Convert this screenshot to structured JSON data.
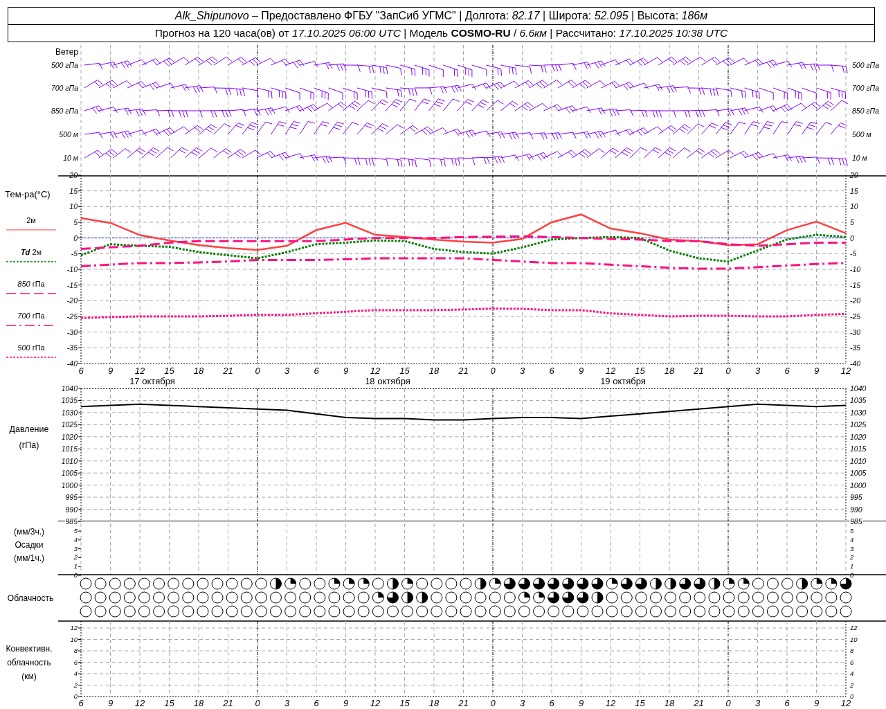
{
  "header": {
    "line_1": "*Alk_Shipunovo* – Предоставлено ФГБУ \"ЗапСиб УГМС\" | Долгота: *82.17* | Широта: *52.095* | Высота: *186м*",
    "line_2": "Прогноз на 120 часа(ов) от *17.10.2025 06:00 UTC* | Модель **COSMO-RU** / *6.6км* | Рассчитано: *17.10.2025 10:38 UTC*"
  },
  "wind": {
    "title": "Ветер",
    "levels": [
      {
        "label": "500 гПа",
        "label_right": "500 гПа"
      },
      {
        "label": "700 гПа",
        "label_right": "700 гПа"
      },
      {
        "label": "850 гПа",
        "label_right": "850 гПа"
      },
      {
        "label": "500 м",
        "label_right": "500 м"
      },
      {
        "label": "10  м",
        "label_right": "10  м"
      }
    ]
  },
  "temperature": {
    "title": "Тем-ра(°C)",
    "right_ticks": [
      "20",
      "15",
      "10",
      "5",
      "0",
      "-5",
      "-10",
      "-15",
      "-20",
      "-25",
      "-30",
      "-35",
      "-40"
    ],
    "dates": [
      "17 октября",
      "18 октября",
      "19 октября"
    ],
    "chart_data": {
      "type": "line",
      "grid": true,
      "ref_lines": [
        {
          "axis": "y",
          "value": 0,
          "color": "#2040ff"
        }
      ],
      "categories": [
        "6",
        "9",
        "12",
        "15",
        "18",
        "21",
        "0",
        "3",
        "6",
        "9",
        "12",
        "15",
        "18",
        "21",
        "0",
        "3",
        "6",
        "9",
        "12",
        "15",
        "18",
        "21",
        "0",
        "3",
        "6",
        "9",
        "12"
      ],
      "ylim": [
        -40,
        20
      ],
      "yticks": [
        20,
        15,
        10,
        5,
        0,
        -5,
        -10,
        -15,
        -20,
        -25,
        -30,
        -35,
        -40
      ],
      "series": [
        {
          "name": "2м",
          "line_style": "solid",
          "color": "#ff4040",
          "values": [
            6.3,
            4.8,
            0.9,
            -0.8,
            -2.3,
            -3.2,
            -3.8,
            -2.5,
            2.5,
            4.8,
            1.0,
            0.3,
            -0.5,
            -1.2,
            -1.5,
            -0.3,
            5.0,
            7.5,
            3.0,
            1.5,
            -0.5,
            -1.0,
            -2.3,
            -2.0,
            2.5,
            5.2,
            1.5
          ]
        },
        {
          "name": "**Td** 2м",
          "line_style": "dotted",
          "color": "#008000",
          "values": [
            -5.5,
            -2.0,
            -2.5,
            -2.8,
            -4.5,
            -5.5,
            -6.5,
            -4.5,
            -2.0,
            -1.5,
            -0.8,
            -1.0,
            -3.5,
            -4.5,
            -5.0,
            -3.0,
            -0.5,
            0.0,
            0.3,
            0.0,
            -4.0,
            -6.5,
            -7.5,
            -4.0,
            -0.5,
            1.0,
            0.3
          ]
        },
        {
          "name": "*850* гПа",
          "line_style": "dashed",
          "color": "#ff1080",
          "values": [
            -3.5,
            -3.0,
            -2.5,
            -1.5,
            -1.0,
            -1.0,
            -1.0,
            -1.0,
            -1.0,
            -0.5,
            0.0,
            0.0,
            0.0,
            0.3,
            0.4,
            0.5,
            0.3,
            0.0,
            -0.3,
            -0.5,
            -1.0,
            -1.0,
            -2.0,
            -2.5,
            -2.0,
            -1.5,
            -1.5
          ]
        },
        {
          "name": "*700* гПа",
          "line_style": "dashdot",
          "color": "#ff1080",
          "values": [
            -9.0,
            -8.5,
            -8.0,
            -8.0,
            -7.8,
            -7.5,
            -7.0,
            -7.0,
            -7.0,
            -6.8,
            -6.5,
            -6.5,
            -6.5,
            -6.5,
            -7.0,
            -7.5,
            -8.0,
            -8.0,
            -8.5,
            -9.0,
            -9.5,
            -9.8,
            -9.8,
            -9.3,
            -8.8,
            -8.3,
            -8.0
          ]
        },
        {
          "name": "*500* гПа",
          "line_style": "dotted",
          "color": "#ff1080",
          "values": [
            -25.5,
            -25.2,
            -25.0,
            -25.0,
            -25.0,
            -24.8,
            -24.5,
            -24.5,
            -24.0,
            -23.5,
            -23.0,
            -23.0,
            -23.0,
            -22.8,
            -22.5,
            -22.6,
            -23.0,
            -23.0,
            -24.0,
            -24.5,
            -25.0,
            -24.8,
            -24.8,
            -25.0,
            -25.0,
            -24.5,
            -24.2
          ]
        }
      ]
    }
  },
  "pressure": {
    "title": "Давление",
    "unit": "(гПа)",
    "right_ticks": [
      "1040",
      "1035",
      "1030",
      "1025",
      "1020",
      "1015",
      "1010",
      "1005",
      "1000",
      "995",
      "990",
      "985"
    ],
    "chart_data": {
      "type": "line",
      "grid": true,
      "ylim": [
        985,
        1040
      ],
      "yticks": [
        1040,
        1035,
        1030,
        1025,
        1020,
        1015,
        1010,
        1005,
        1000,
        995,
        990,
        985
      ],
      "series": [
        {
          "color": "#000000",
          "values": [
            1032.5,
            1033,
            1033.5,
            1033,
            1032.5,
            1032,
            1031.5,
            1031,
            1029.5,
            1028,
            1027.5,
            1027.5,
            1027,
            1027,
            1027.5,
            1028,
            1028,
            1027.5,
            1028.5,
            1029.5,
            1030.5,
            1031.5,
            1032.5,
            1033.5,
            1033,
            1032.5,
            1033
          ]
        }
      ]
    }
  },
  "precipitation": {
    "unit_top": "(мм/3ч.)",
    "title": "Осадки",
    "unit_bottom": "(мм/1ч.)",
    "ticks": [
      "5",
      "4",
      "3",
      "2",
      "1",
      "0"
    ],
    "right_ticks": [
      "5",
      "4",
      "3",
      "2",
      "1",
      "0"
    ]
  },
  "cloudiness": {
    "title": "Облачность",
    "rows": [
      {
        "cells": [
          {
            "kind": "clear"
          },
          {
            "kind": "clear"
          },
          {
            "kind": "clear"
          },
          {
            "kind": "clear"
          },
          {
            "kind": "clear"
          },
          {
            "kind": "clear"
          },
          {
            "kind": "clear"
          },
          {
            "kind": "clear"
          },
          {
            "kind": "clear"
          },
          {
            "kind": "clear"
          },
          {
            "kind": "clear"
          },
          {
            "kind": "clear"
          },
          {
            "kind": "clear"
          },
          {
            "kind": "half"
          },
          {
            "kind": "quarter"
          },
          {
            "kind": "clear"
          },
          {
            "kind": "clear"
          },
          {
            "kind": "quarter"
          },
          {
            "kind": "quarter"
          },
          {
            "kind": "quarter"
          },
          {
            "kind": "clear"
          },
          {
            "kind": "half"
          },
          {
            "kind": "quarter"
          },
          {
            "kind": "clear"
          },
          {
            "kind": "clear"
          },
          {
            "kind": "clear"
          },
          {
            "kind": "clear"
          },
          {
            "kind": "half"
          },
          {
            "kind": "quarter"
          },
          {
            "kind": "three_quarters"
          },
          {
            "kind": "three_quarters"
          },
          {
            "kind": "three_quarters"
          },
          {
            "kind": "three_quarters"
          },
          {
            "kind": "three_quarters"
          },
          {
            "kind": "three_quarters"
          },
          {
            "kind": "three_quarters"
          },
          {
            "kind": "quarter"
          },
          {
            "kind": "three_quarters"
          },
          {
            "kind": "three_quarters"
          },
          {
            "kind": "half"
          },
          {
            "kind": "half"
          },
          {
            "kind": "three_quarters"
          },
          {
            "kind": "three_quarters"
          },
          {
            "kind": "half"
          },
          {
            "kind": "quarter"
          },
          {
            "kind": "quarter"
          },
          {
            "kind": "clear"
          },
          {
            "kind": "clear"
          },
          {
            "kind": "clear"
          },
          {
            "kind": "half"
          },
          {
            "kind": "quarter"
          },
          {
            "kind": "quarter"
          },
          {
            "kind": "three_quarters"
          }
        ]
      },
      {
        "cells": [
          {
            "kind": "clear"
          },
          {
            "kind": "clear"
          },
          {
            "kind": "clear"
          },
          {
            "kind": "clear"
          },
          {
            "kind": "clear"
          },
          {
            "kind": "clear"
          },
          {
            "kind": "clear"
          },
          {
            "kind": "clear"
          },
          {
            "kind": "clear"
          },
          {
            "kind": "clear"
          },
          {
            "kind": "clear"
          },
          {
            "kind": "clear"
          },
          {
            "kind": "clear"
          },
          {
            "kind": "clear"
          },
          {
            "kind": "clear"
          },
          {
            "kind": "clear"
          },
          {
            "kind": "clear"
          },
          {
            "kind": "clear"
          },
          {
            "kind": "clear"
          },
          {
            "kind": "clear"
          },
          {
            "kind": "quarter"
          },
          {
            "kind": "three_quarters"
          },
          {
            "kind": "half"
          },
          {
            "kind": "half"
          },
          {
            "kind": "clear"
          },
          {
            "kind": "clear"
          },
          {
            "kind": "clear"
          },
          {
            "kind": "clear"
          },
          {
            "kind": "clear"
          },
          {
            "kind": "clear"
          },
          {
            "kind": "quarter"
          },
          {
            "kind": "quarter"
          },
          {
            "kind": "three_quarters"
          },
          {
            "kind": "three_quarters"
          },
          {
            "kind": "three_quarters"
          },
          {
            "kind": "half"
          },
          {
            "kind": "clear"
          },
          {
            "kind": "clear"
          },
          {
            "kind": "clear"
          },
          {
            "kind": "clear"
          },
          {
            "kind": "clear"
          },
          {
            "kind": "clear"
          },
          {
            "kind": "clear"
          },
          {
            "kind": "clear"
          },
          {
            "kind": "clear"
          },
          {
            "kind": "clear"
          },
          {
            "kind": "clear"
          },
          {
            "kind": "clear"
          },
          {
            "kind": "clear"
          },
          {
            "kind": "clear"
          },
          {
            "kind": "clear"
          },
          {
            "kind": "clear"
          },
          {
            "kind": "clear"
          }
        ]
      },
      {
        "cells": [
          {
            "kind": "clear"
          },
          {
            "kind": "clear"
          },
          {
            "kind": "clear"
          },
          {
            "kind": "clear"
          },
          {
            "kind": "clear"
          },
          {
            "kind": "clear"
          },
          {
            "kind": "clear"
          },
          {
            "kind": "clear"
          },
          {
            "kind": "clear"
          },
          {
            "kind": "clear"
          },
          {
            "kind": "clear"
          },
          {
            "kind": "clear"
          },
          {
            "kind": "clear"
          },
          {
            "kind": "clear"
          },
          {
            "kind": "clear"
          },
          {
            "kind": "clear"
          },
          {
            "kind": "clear"
          },
          {
            "kind": "clear"
          },
          {
            "kind": "clear"
          },
          {
            "kind": "clear"
          },
          {
            "kind": "clear"
          },
          {
            "kind": "clear"
          },
          {
            "kind": "clear"
          },
          {
            "kind": "clear"
          },
          {
            "kind": "clear"
          },
          {
            "kind": "clear"
          },
          {
            "kind": "clear"
          },
          {
            "kind": "clear"
          },
          {
            "kind": "clear"
          },
          {
            "kind": "clear"
          },
          {
            "kind": "clear"
          },
          {
            "kind": "clear"
          },
          {
            "kind": "clear"
          },
          {
            "kind": "clear"
          },
          {
            "kind": "clear"
          },
          {
            "kind": "clear"
          },
          {
            "kind": "clear"
          },
          {
            "kind": "clear"
          },
          {
            "kind": "clear"
          },
          {
            "kind": "clear"
          },
          {
            "kind": "clear"
          },
          {
            "kind": "clear"
          },
          {
            "kind": "clear"
          },
          {
            "kind": "clear"
          },
          {
            "kind": "clear"
          },
          {
            "kind": "clear"
          },
          {
            "kind": "clear"
          },
          {
            "kind": "clear"
          },
          {
            "kind": "clear"
          },
          {
            "kind": "clear"
          },
          {
            "kind": "clear"
          },
          {
            "kind": "clear"
          },
          {
            "kind": "clear"
          }
        ]
      }
    ]
  },
  "convective": {
    "title_1": "Конвективн.",
    "title_2": "облачность",
    "unit": "(км)",
    "ticks": [
      "12",
      "10",
      "8",
      "6",
      "4",
      "2",
      "0"
    ],
    "right_ticks": [
      "12",
      "10",
      "8",
      "6",
      "4",
      "2",
      "0"
    ]
  },
  "bottom_axis": [
    "6",
    "9",
    "12",
    "15",
    "18",
    "21",
    "0",
    "3",
    "6",
    "9",
    "12",
    "15",
    "18",
    "21",
    "0",
    "3",
    "6",
    "9",
    "12",
    "15",
    "18",
    "21",
    "0",
    "3",
    "6",
    "9",
    "12"
  ]
}
